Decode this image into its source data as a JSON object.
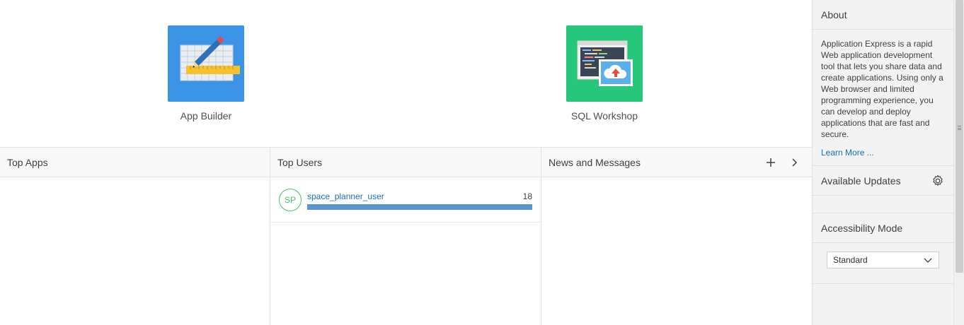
{
  "tiles": {
    "app_builder": {
      "label": "App Builder",
      "icon": "app-builder-icon",
      "color": "#3b94e6"
    },
    "sql_workshop": {
      "label": "SQL Workshop",
      "icon": "sql-workshop-icon",
      "color": "#26c77a"
    }
  },
  "panels": {
    "top_apps": {
      "title": "Top Apps"
    },
    "top_users": {
      "title": "Top Users",
      "users": [
        {
          "initials": "SP",
          "name": "space_planner_user",
          "count": "18",
          "fraction": 1.0
        }
      ]
    },
    "news": {
      "title": "News and Messages",
      "add_icon": "plus-icon",
      "next_icon": "chevron-right-icon"
    }
  },
  "sidebar": {
    "about": {
      "title": "About",
      "text": "Application Express is a rapid Web application development tool that lets you share data and create applications. Using only a Web browser and limited programming experience, you can develop and deploy applications that are fast and secure.",
      "link": "Learn More ..."
    },
    "updates": {
      "title": "Available Updates",
      "icon": "gear-icon"
    },
    "accessibility": {
      "title": "Accessibility Mode",
      "selected": "Standard"
    }
  },
  "colors": {
    "link": "#1a6fb5",
    "avatar_border": "#4cc06a",
    "bar": "#5b95cf"
  }
}
